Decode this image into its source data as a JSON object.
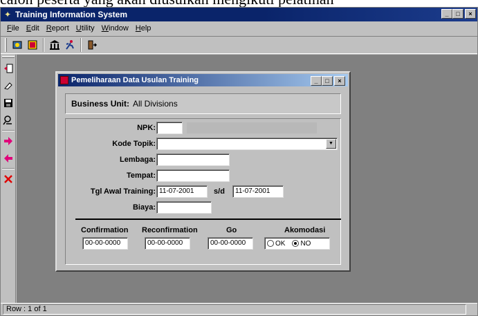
{
  "background_text": "calon peserta yang akan diusulkan mengikuti pelatihan",
  "app": {
    "title": "Training Information System",
    "min": "_",
    "max": "□",
    "close": "×"
  },
  "menu": [
    {
      "key": "F",
      "rest": "ile"
    },
    {
      "key": "E",
      "rest": "dit"
    },
    {
      "key": "R",
      "rest": "eport"
    },
    {
      "key": "U",
      "rest": "tility"
    },
    {
      "key": "W",
      "rest": "indow"
    },
    {
      "key": "H",
      "rest": "elp"
    }
  ],
  "status": {
    "row": "Row : 1 of 1"
  },
  "child": {
    "title": "Pemeliharaan Data Usulan Training",
    "business_unit_label": "Business Unit:",
    "business_unit_value": "All Divisions",
    "fields": {
      "npk_label": "NPK:",
      "npk_value": "",
      "kode_topik_label": "Kode Topik:",
      "kode_topik_value": "",
      "lembaga_label": "Lembaga:",
      "lembaga_value": "",
      "tempat_label": "Tempat:",
      "tempat_value": "",
      "tgl_awal_label": "Tgl Awal Training:",
      "tgl_awal_value": "11-07-2001",
      "sd_label": "s/d",
      "tgl_akhir_value": "11-07-2001",
      "biaya_label": "Biaya:",
      "biaya_value": ""
    },
    "columns": {
      "confirmation_label": "Confirmation",
      "confirmation_value": "00-00-0000",
      "reconfirmation_label": "Reconfirmation",
      "reconfirmation_value": "00-00-0000",
      "go_label": "Go",
      "go_value": "00-00-0000",
      "akomodasi_label": "Akomodasi",
      "ok_label": "OK",
      "no_label": "NO",
      "akomodasi_selected": "NO"
    }
  },
  "colors": {
    "title_active": "#0a246a",
    "face": "#c0c0c0",
    "mdi_bg": "#808080"
  }
}
